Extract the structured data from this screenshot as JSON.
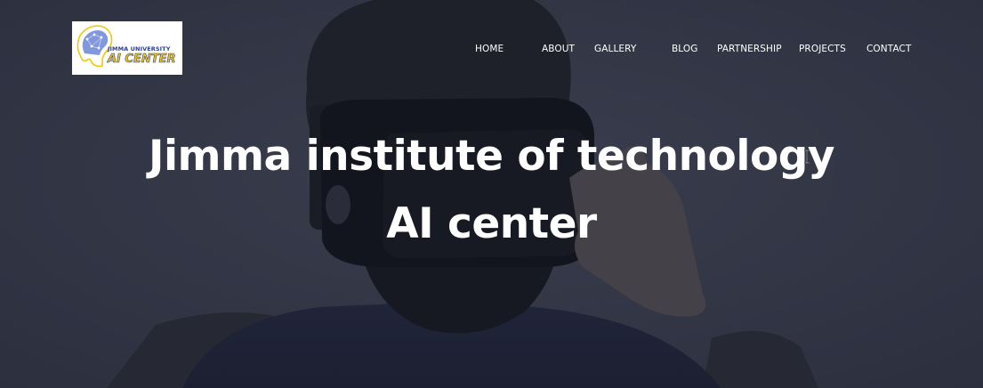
{
  "logo": {
    "line1": "JIMMA UNIVERSITY",
    "line2": "AI CENTER",
    "icon": "brain-network-icon",
    "colors": {
      "blue": "#2a3f8f",
      "yellow": "#f2c70a"
    }
  },
  "nav": {
    "items": [
      {
        "label": "HOME"
      },
      {
        "label": "ABOUT"
      },
      {
        "label": "GALLERY"
      },
      {
        "label": "BLOG"
      },
      {
        "label": "PARTNERSHIP"
      },
      {
        "label": "PROJECTS"
      },
      {
        "label": "CONTACT"
      }
    ]
  },
  "hero": {
    "title_line1": "Jimma institute of technology",
    "title_line2": "AI center",
    "background": "person-wearing-vr-headset-photo",
    "overlay_color": "#2b2e3c"
  }
}
